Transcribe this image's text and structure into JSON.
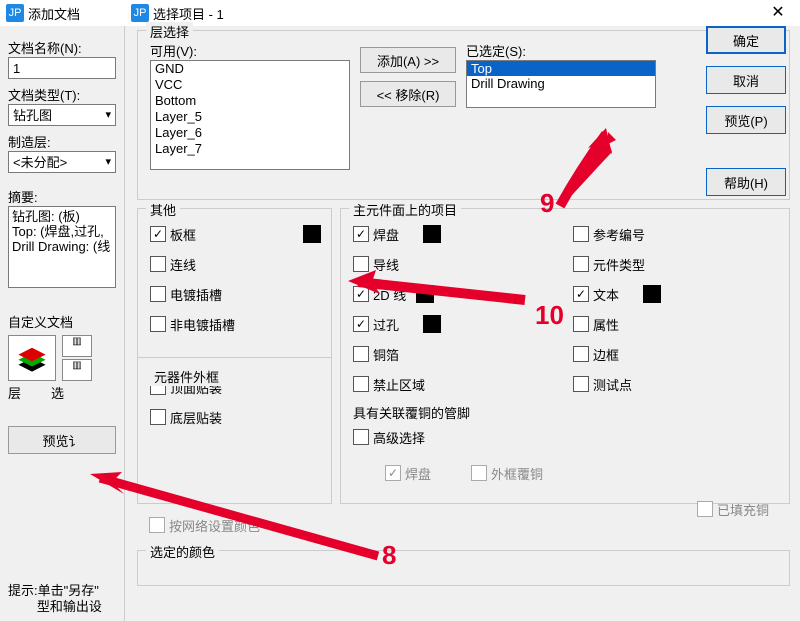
{
  "titles": {
    "left": "添加文档",
    "main": "选择项目 - 1"
  },
  "left": {
    "name_label": "文档名称(N):",
    "name_value": "1",
    "type_label": "文档类型(T):",
    "type_value": "钻孔图",
    "mfg_label": "制造层:",
    "mfg_value": "<未分配>",
    "summary_label": "摘要:",
    "summary_lines": [
      "钻孔图: (板)",
      "Top: (焊盘,过孔,",
      "Drill Drawing: (线"
    ],
    "custom_label": "自定义文档",
    "sub_labels": {
      "layer": "层",
      "sel": "选"
    },
    "preview_btn": "预览讠",
    "tip": "提示:单击\"另存\"\n        型和输出设"
  },
  "group_layer": {
    "title": "层选择",
    "avail_label": "可用(V):",
    "avail_items": [
      "GND",
      "VCC",
      "Bottom",
      "Layer_5",
      "Layer_6",
      "Layer_7"
    ],
    "add_btn": "添加(A) >>",
    "remove_btn": "<< 移除(R)",
    "selected_label": "已选定(S):",
    "selected_items": [
      "Top",
      "Drill Drawing"
    ]
  },
  "group_other": {
    "title": "其他",
    "items": [
      {
        "label": "板框",
        "checked": true,
        "swatch": true
      },
      {
        "label": "连线",
        "checked": false
      },
      {
        "label": "电镀插槽",
        "checked": false
      },
      {
        "label": "非电镀插槽",
        "checked": false
      }
    ],
    "outline_title": "元器件外框",
    "outline_items": [
      {
        "label": "顶面贴装",
        "checked": false
      },
      {
        "label": "底层贴装",
        "checked": false
      }
    ]
  },
  "group_comp": {
    "title": "主元件面上的项目",
    "col1": [
      {
        "label": "焊盘",
        "checked": true,
        "swatch": true
      },
      {
        "label": "导线",
        "checked": false
      },
      {
        "label": "2D 线",
        "checked": true,
        "swatch": true
      },
      {
        "label": "过孔",
        "checked": true,
        "swatch": true
      },
      {
        "label": "铜箔",
        "checked": false
      },
      {
        "label": "禁止区域",
        "checked": false
      }
    ],
    "col2": [
      {
        "label": "参考编号",
        "checked": false
      },
      {
        "label": "元件类型",
        "checked": false
      },
      {
        "label": "文本",
        "checked": true,
        "swatch": true
      },
      {
        "label": "属性",
        "checked": false
      },
      {
        "label": "边框",
        "checked": false
      },
      {
        "label": "测试点",
        "checked": false
      }
    ],
    "assoc_title": "具有关联覆铜的管脚",
    "adv_label": "高级选择",
    "lower": [
      {
        "label": "焊盘",
        "checked": true,
        "disabled": true
      },
      {
        "label": "外框覆铜",
        "checked": false,
        "disabled": true
      },
      {
        "label": "已填充铜",
        "checked": false,
        "disabled": true
      }
    ]
  },
  "net_color": {
    "label": "按网络设置颜色",
    "disabled": true
  },
  "selected_color_title": "选定的颜色",
  "buttons": {
    "ok": "确定",
    "cancel": "取消",
    "preview": "预览(P)",
    "help": "帮助(H)"
  },
  "anno": {
    "n8": "8",
    "n9": "9",
    "n10": "10"
  }
}
